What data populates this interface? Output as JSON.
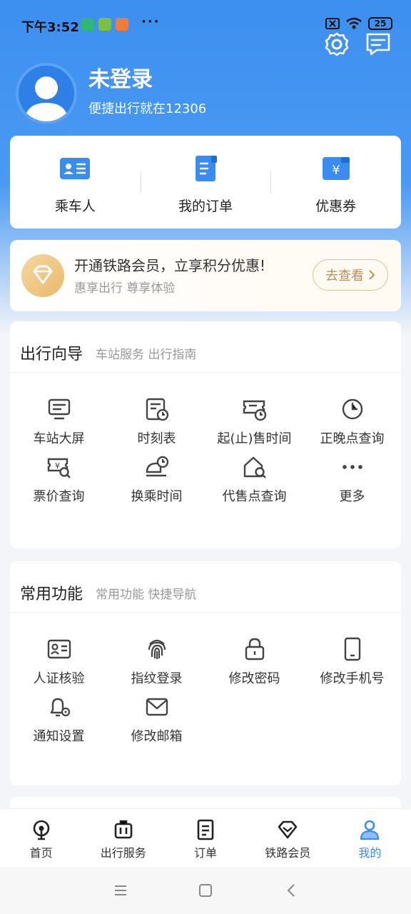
{
  "status_bar": {
    "time": "下午3:52",
    "more": "···",
    "battery": "25"
  },
  "header": {
    "title": "未登录",
    "subtitle": "便捷出行就在12306"
  },
  "quick_actions": [
    {
      "label": "乘车人",
      "icon": "passenger-card-icon"
    },
    {
      "label": "我的订单",
      "icon": "order-icon"
    },
    {
      "label": "优惠券",
      "icon": "coupon-icon"
    }
  ],
  "member": {
    "title": "开通铁路会员，立享积分优惠!",
    "subtitle": "惠享出行 尊享体验",
    "button": "去查看"
  },
  "travel_guide": {
    "title": "出行向导",
    "subtitle": "车站服务 出行指南",
    "items": [
      "车站大屏",
      "时刻表",
      "起(止)售时间",
      "正晚点查询",
      "票价查询",
      "换乘时间",
      "代售点查询",
      "更多"
    ]
  },
  "common_functions": {
    "title": "常用功能",
    "subtitle": "常用功能 快捷导航",
    "items": [
      "人证核验",
      "指纹登录",
      "修改密码",
      "修改手机号",
      "通知设置",
      "修改邮箱"
    ]
  },
  "tabbar": [
    {
      "label": "首页"
    },
    {
      "label": "出行服务"
    },
    {
      "label": "订单"
    },
    {
      "label": "铁路会员"
    },
    {
      "label": "我的",
      "active": true
    }
  ],
  "colors": {
    "accent": "#3a8ef0",
    "gold": "#b8925a"
  }
}
